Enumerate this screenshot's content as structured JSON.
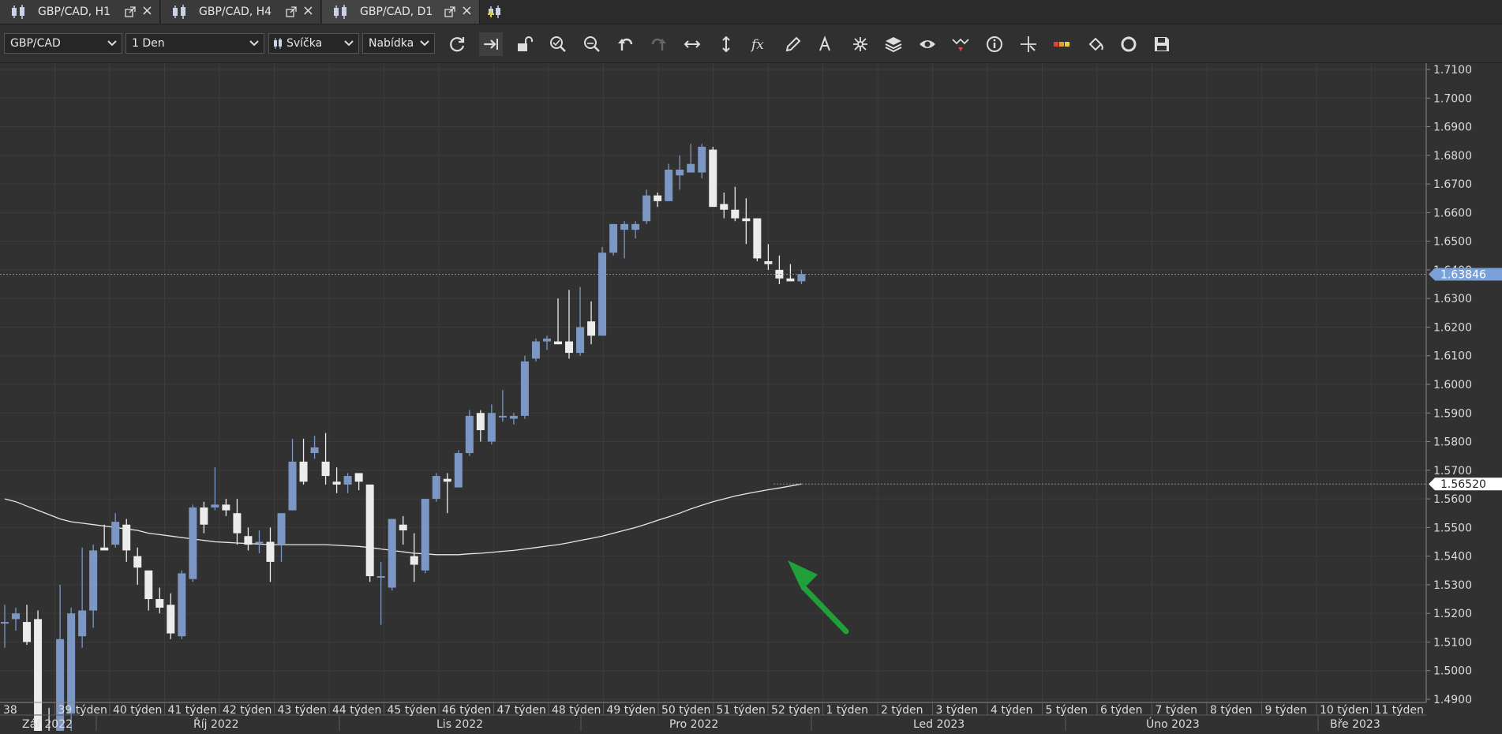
{
  "tabs": [
    {
      "label": "GBP/CAD, H1",
      "active": false
    },
    {
      "label": "GBP/CAD, H4",
      "active": false
    },
    {
      "label": "GBP/CAD, D1",
      "active": true
    }
  ],
  "toolbar": {
    "symbol": "GBP/CAD",
    "timeframe": "1 Den",
    "chart_type": "Svíčka",
    "price_side": "Nabídka",
    "icons": [
      "refresh-icon",
      "autoscroll-icon",
      "unlock-icon",
      "zoom-in-icon",
      "zoom-out-icon",
      "undo-icon",
      "redo-icon",
      "fit-horizontal-icon",
      "fit-vertical-icon",
      "indicator-fx-icon",
      "pencil-draw-icon",
      "text-tool-icon",
      "crosshair-icon",
      "layers-icon",
      "eye-icon",
      "pattern-icon",
      "info-icon",
      "cursor-cross-icon",
      "color-bar-icon",
      "fill-bucket-icon",
      "sync-icon",
      "save-icon"
    ]
  },
  "colors": {
    "background": "#313131",
    "bull": "#7d97c4",
    "bear": "#ececec",
    "grid": "#3c3c3c",
    "arrow": "#20a03a",
    "price_label": "#7aa0d8"
  },
  "chart_data": {
    "type": "candlestick",
    "y_ticks": [
      "1.7100",
      "1.7000",
      "1.6900",
      "1.6800",
      "1.6700",
      "1.6600",
      "1.6500",
      "1.6400",
      "1.6300",
      "1.6200",
      "1.6100",
      "1.6000",
      "1.5900",
      "1.5800",
      "1.5700",
      "1.5600",
      "1.5500",
      "1.5400",
      "1.5300",
      "1.5200",
      "1.5100",
      "1.5000",
      "1.4900"
    ],
    "ylim": [
      1.49,
      1.71
    ],
    "last_price": "1.63846",
    "ma_value": "1.56520",
    "week_labels": [
      "38",
      "39 týden",
      "40 týden",
      "41 týden",
      "42 týden",
      "43 týden",
      "44 týden",
      "45 týden",
      "46 týden",
      "47 týden",
      "48 týden",
      "49 týden",
      "50 týden",
      "51 týden",
      "52 týden",
      "1 týden",
      "2 týden",
      "3 týden",
      "4 týden",
      "5 týden",
      "6 týden",
      "7 týden",
      "8 týden",
      "9 týden",
      "10 týden",
      "11 týden"
    ],
    "month_labels": [
      "Zář 2022",
      "Říj 2022",
      "Lis 2022",
      "Pro 2022",
      "Led 2023",
      "Úno 2023",
      "Bře 2023"
    ],
    "candles": [
      {
        "o": 1.517,
        "h": 1.523,
        "l": 1.508,
        "c": 1.517
      },
      {
        "o": 1.518,
        "h": 1.522,
        "l": 1.514,
        "c": 1.52
      },
      {
        "o": 1.517,
        "h": 1.523,
        "l": 1.509,
        "c": 1.51
      },
      {
        "o": 1.518,
        "h": 1.521,
        "l": 1.472,
        "c": 1.475
      },
      {
        "o": 1.475,
        "h": 1.487,
        "l": 1.469,
        "c": 1.473
      },
      {
        "o": 1.476,
        "h": 1.53,
        "l": 1.472,
        "c": 1.511
      },
      {
        "o": 1.485,
        "h": 1.522,
        "l": 1.472,
        "c": 1.52
      },
      {
        "o": 1.512,
        "h": 1.543,
        "l": 1.508,
        "c": 1.521
      },
      {
        "o": 1.521,
        "h": 1.544,
        "l": 1.515,
        "c": 1.542
      },
      {
        "o": 1.543,
        "h": 1.551,
        "l": 1.542,
        "c": 1.542
      },
      {
        "o": 1.544,
        "h": 1.555,
        "l": 1.543,
        "c": 1.552
      },
      {
        "o": 1.551,
        "h": 1.553,
        "l": 1.538,
        "c": 1.542
      },
      {
        "o": 1.54,
        "h": 1.543,
        "l": 1.53,
        "c": 1.536
      },
      {
        "o": 1.535,
        "h": 1.535,
        "l": 1.521,
        "c": 1.525
      },
      {
        "o": 1.525,
        "h": 1.529,
        "l": 1.52,
        "c": 1.522
      },
      {
        "o": 1.523,
        "h": 1.527,
        "l": 1.511,
        "c": 1.513
      },
      {
        "o": 1.512,
        "h": 1.535,
        "l": 1.511,
        "c": 1.534
      },
      {
        "o": 1.532,
        "h": 1.558,
        "l": 1.531,
        "c": 1.557
      },
      {
        "o": 1.557,
        "h": 1.559,
        "l": 1.548,
        "c": 1.551
      },
      {
        "o": 1.557,
        "h": 1.571,
        "l": 1.556,
        "c": 1.558
      },
      {
        "o": 1.558,
        "h": 1.56,
        "l": 1.554,
        "c": 1.556
      },
      {
        "o": 1.555,
        "h": 1.56,
        "l": 1.544,
        "c": 1.548
      },
      {
        "o": 1.547,
        "h": 1.55,
        "l": 1.542,
        "c": 1.544
      },
      {
        "o": 1.545,
        "h": 1.549,
        "l": 1.541,
        "c": 1.545
      },
      {
        "o": 1.545,
        "h": 1.55,
        "l": 1.531,
        "c": 1.538
      },
      {
        "o": 1.544,
        "h": 1.555,
        "l": 1.538,
        "c": 1.555
      },
      {
        "o": 1.556,
        "h": 1.581,
        "l": 1.556,
        "c": 1.573
      },
      {
        "o": 1.573,
        "h": 1.581,
        "l": 1.565,
        "c": 1.566
      },
      {
        "o": 1.576,
        "h": 1.582,
        "l": 1.574,
        "c": 1.578
      },
      {
        "o": 1.573,
        "h": 1.583,
        "l": 1.565,
        "c": 1.568
      },
      {
        "o": 1.566,
        "h": 1.571,
        "l": 1.562,
        "c": 1.565
      },
      {
        "o": 1.565,
        "h": 1.569,
        "l": 1.562,
        "c": 1.568
      },
      {
        "o": 1.569,
        "h": 1.569,
        "l": 1.563,
        "c": 1.566
      },
      {
        "o": 1.565,
        "h": 1.565,
        "l": 1.531,
        "c": 1.533
      },
      {
        "o": 1.533,
        "h": 1.538,
        "l": 1.516,
        "c": 1.533
      },
      {
        "o": 1.529,
        "h": 1.553,
        "l": 1.528,
        "c": 1.553
      },
      {
        "o": 1.551,
        "h": 1.554,
        "l": 1.544,
        "c": 1.549
      },
      {
        "o": 1.54,
        "h": 1.548,
        "l": 1.531,
        "c": 1.537
      },
      {
        "o": 1.535,
        "h": 1.56,
        "l": 1.534,
        "c": 1.56
      },
      {
        "o": 1.56,
        "h": 1.569,
        "l": 1.559,
        "c": 1.568
      },
      {
        "o": 1.567,
        "h": 1.569,
        "l": 1.555,
        "c": 1.566
      },
      {
        "o": 1.564,
        "h": 1.577,
        "l": 1.564,
        "c": 1.576
      },
      {
        "o": 1.576,
        "h": 1.591,
        "l": 1.575,
        "c": 1.589
      },
      {
        "o": 1.59,
        "h": 1.591,
        "l": 1.58,
        "c": 1.584
      },
      {
        "o": 1.58,
        "h": 1.593,
        "l": 1.579,
        "c": 1.59
      },
      {
        "o": 1.589,
        "h": 1.598,
        "l": 1.587,
        "c": 1.589
      },
      {
        "o": 1.588,
        "h": 1.59,
        "l": 1.586,
        "c": 1.589
      },
      {
        "o": 1.589,
        "h": 1.61,
        "l": 1.588,
        "c": 1.608
      },
      {
        "o": 1.609,
        "h": 1.616,
        "l": 1.608,
        "c": 1.615
      },
      {
        "o": 1.615,
        "h": 1.617,
        "l": 1.612,
        "c": 1.616
      },
      {
        "o": 1.615,
        "h": 1.63,
        "l": 1.614,
        "c": 1.614
      },
      {
        "o": 1.615,
        "h": 1.633,
        "l": 1.609,
        "c": 1.611
      },
      {
        "o": 1.611,
        "h": 1.634,
        "l": 1.61,
        "c": 1.62
      },
      {
        "o": 1.622,
        "h": 1.629,
        "l": 1.614,
        "c": 1.617
      },
      {
        "o": 1.617,
        "h": 1.648,
        "l": 1.617,
        "c": 1.646
      },
      {
        "o": 1.646,
        "h": 1.656,
        "l": 1.645,
        "c": 1.656
      },
      {
        "o": 1.654,
        "h": 1.657,
        "l": 1.644,
        "c": 1.656
      },
      {
        "o": 1.654,
        "h": 1.657,
        "l": 1.651,
        "c": 1.656
      },
      {
        "o": 1.657,
        "h": 1.668,
        "l": 1.656,
        "c": 1.666
      },
      {
        "o": 1.666,
        "h": 1.667,
        "l": 1.662,
        "c": 1.664
      },
      {
        "o": 1.664,
        "h": 1.677,
        "l": 1.664,
        "c": 1.675
      },
      {
        "o": 1.673,
        "h": 1.68,
        "l": 1.668,
        "c": 1.675
      },
      {
        "o": 1.674,
        "h": 1.684,
        "l": 1.674,
        "c": 1.677
      },
      {
        "o": 1.674,
        "h": 1.684,
        "l": 1.672,
        "c": 1.683
      },
      {
        "o": 1.682,
        "h": 1.683,
        "l": 1.662,
        "c": 1.662
      },
      {
        "o": 1.663,
        "h": 1.667,
        "l": 1.658,
        "c": 1.661
      },
      {
        "o": 1.661,
        "h": 1.669,
        "l": 1.657,
        "c": 1.658
      },
      {
        "o": 1.658,
        "h": 1.665,
        "l": 1.649,
        "c": 1.657
      },
      {
        "o": 1.658,
        "h": 1.658,
        "l": 1.643,
        "c": 1.644
      },
      {
        "o": 1.643,
        "h": 1.649,
        "l": 1.64,
        "c": 1.642
      },
      {
        "o": 1.64,
        "h": 1.645,
        "l": 1.635,
        "c": 1.637
      },
      {
        "o": 1.637,
        "h": 1.642,
        "l": 1.636,
        "c": 1.636
      },
      {
        "o": 1.636,
        "h": 1.64,
        "l": 1.635,
        "c": 1.6385
      }
    ],
    "ma": [
      1.56,
      1.559,
      1.5575,
      1.556,
      1.5545,
      1.553,
      1.552,
      1.5515,
      1.551,
      1.5505,
      1.55,
      1.5495,
      1.549,
      1.548,
      1.5475,
      1.547,
      1.5465,
      1.546,
      1.5455,
      1.545,
      1.5448,
      1.5446,
      1.5444,
      1.5442,
      1.544,
      1.544,
      1.544,
      1.544,
      1.544,
      1.544,
      1.5438,
      1.5436,
      1.5434,
      1.543,
      1.5425,
      1.542,
      1.5415,
      1.541,
      1.5408,
      1.5405,
      1.5405,
      1.5405,
      1.5408,
      1.541,
      1.5413,
      1.5417,
      1.542,
      1.5425,
      1.543,
      1.5435,
      1.544,
      1.5447,
      1.5455,
      1.5462,
      1.547,
      1.548,
      1.549,
      1.55,
      1.5512,
      1.5525,
      1.5537,
      1.555,
      1.5565,
      1.5578,
      1.559,
      1.56,
      1.561,
      1.5618,
      1.5625,
      1.5632,
      1.5638,
      1.5645,
      1.5652
    ]
  }
}
